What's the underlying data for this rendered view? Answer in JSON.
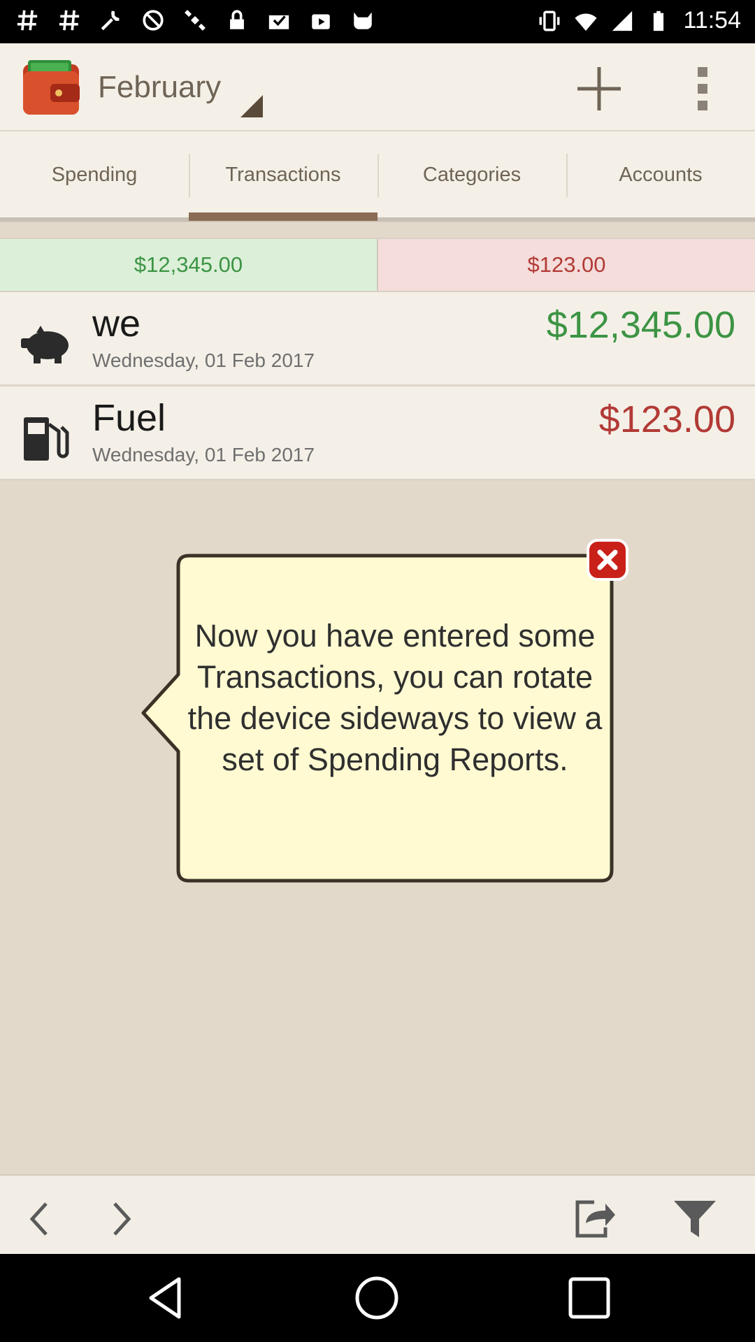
{
  "status_bar": {
    "time": "11:54",
    "icons": [
      "hashtag-icon",
      "hashtag-icon",
      "wrench-icon",
      "blocked-icon",
      "satellite-icon",
      "lock-icon",
      "mail-check-icon",
      "play-store-icon",
      "cat-icon",
      "vibrate-icon",
      "wifi-icon",
      "signal-icon",
      "battery-icon"
    ]
  },
  "app_bar": {
    "month": "February",
    "logo_icon": "wallet-icon",
    "add_icon": "plus-icon",
    "menu_icon": "overflow-menu-icon"
  },
  "tabs": [
    {
      "label": "Spending",
      "active": false
    },
    {
      "label": "Transactions",
      "active": true
    },
    {
      "label": "Categories",
      "active": false
    },
    {
      "label": "Accounts",
      "active": false
    }
  ],
  "totals": {
    "income": "$12,345.00",
    "expense": "$123.00"
  },
  "transactions": [
    {
      "name": "we",
      "date": "Wednesday, 01 Feb 2017",
      "amount": "$12,345.00",
      "type": "income",
      "icon": "piggy-bank-icon"
    },
    {
      "name": "Fuel",
      "date": "Wednesday, 01 Feb 2017",
      "amount": "$123.00",
      "type": "expense",
      "icon": "fuel-pump-icon"
    }
  ],
  "tip": {
    "text": "Now you have entered some Transactions, you can rotate the device sideways to view a set of Spending Reports."
  },
  "bottom_bar": {
    "icons": [
      "chevron-left-icon",
      "chevron-right-icon",
      "export-icon",
      "filter-icon"
    ]
  },
  "colors": {
    "income_green": "#3c9444",
    "expense_red": "#b23a35",
    "background": "#e3d9cb",
    "tip_fill": "#fffad2"
  }
}
